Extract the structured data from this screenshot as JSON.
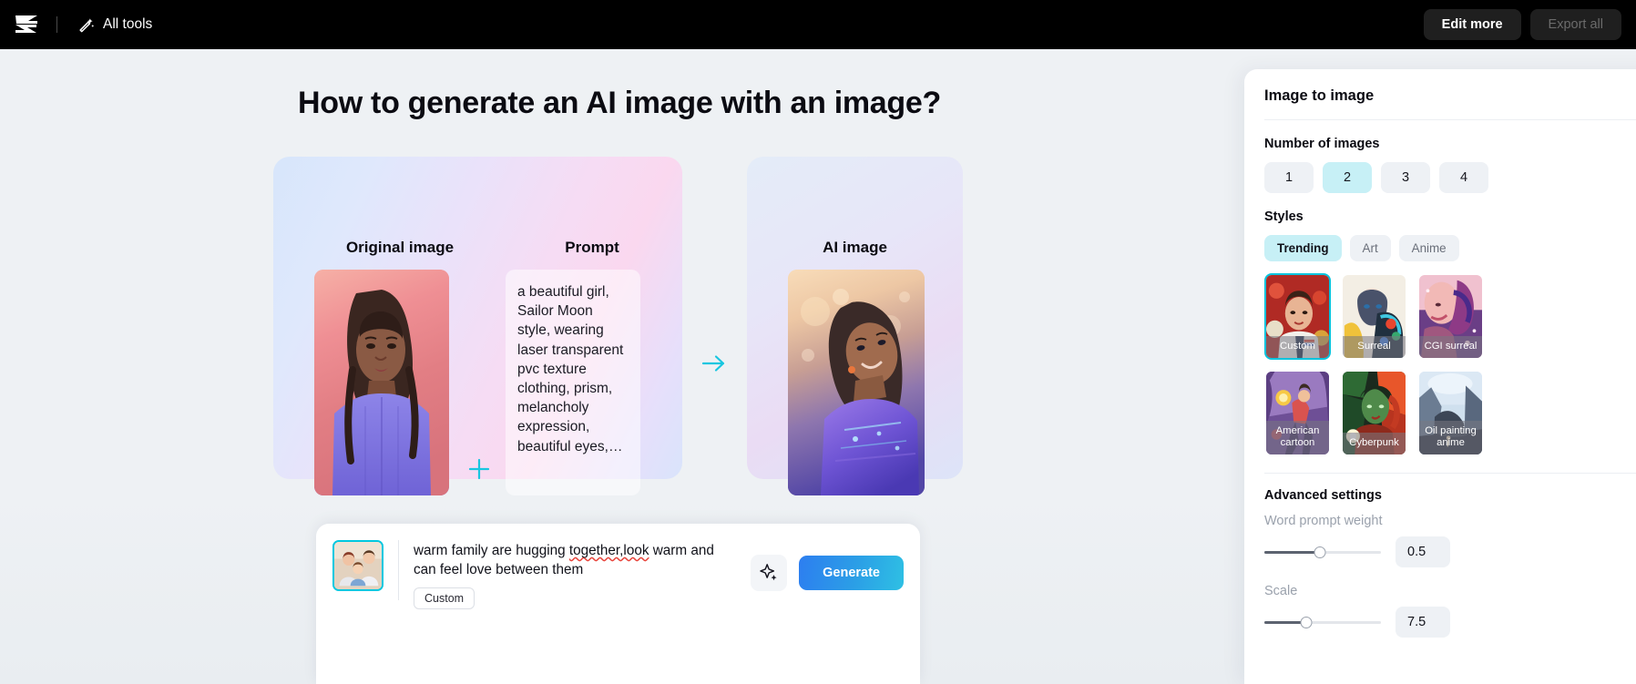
{
  "topbar": {
    "logo_icon": "capcut-logo-icon",
    "all_tools_label": "All tools",
    "wand_icon": "magic-wand-icon",
    "edit_more_label": "Edit more",
    "export_all_label": "Export all"
  },
  "main": {
    "title": "How to generate an AI image with an image?",
    "left_card": {
      "original_heading": "Original image",
      "prompt_heading": "Prompt",
      "prompt_text": "a beautiful girl, Sailor Moon style, wearing laser transparent pvc texture clothing, prism, melancholy expression, beautiful eyes,…",
      "plus_icon": "plus-icon",
      "plus_color": "#18c6e0"
    },
    "arrow_icon": "arrow-right-icon",
    "arrow_color": "#18c6e0",
    "right_card": {
      "ai_heading": "AI image"
    }
  },
  "prompt_bar": {
    "thumbnail_icon": "family-photo-thumbnail",
    "prompt_before": "warm family are hugging ",
    "prompt_misspelled": "together,look",
    "prompt_after": " warm and can feel love between them",
    "style_tag": "Custom",
    "magic_icon": "sparkle-icon",
    "generate_label": "Generate",
    "generate_color": "#2b8fe9"
  },
  "panel": {
    "title": "Image to image",
    "number_of_images": {
      "label": "Number of images",
      "options": [
        "1",
        "2",
        "3",
        "4"
      ],
      "selected": "2"
    },
    "styles": {
      "label": "Styles",
      "tabs": [
        {
          "label": "Trending",
          "selected": true
        },
        {
          "label": "Art",
          "selected": false
        },
        {
          "label": "Anime",
          "selected": false
        }
      ],
      "cards": [
        {
          "name": "Custom",
          "selected": true,
          "two_line": false
        },
        {
          "name": "Surreal",
          "selected": false,
          "two_line": false
        },
        {
          "name": "CGI surreal",
          "selected": false,
          "two_line": false
        },
        {
          "name": "American cartoon",
          "selected": false,
          "two_line": true
        },
        {
          "name": "Cyberpunk",
          "selected": false,
          "two_line": false
        },
        {
          "name": "Oil painting anime",
          "selected": false,
          "two_line": true
        }
      ]
    },
    "advanced": {
      "label": "Advanced settings",
      "word_prompt_weight": {
        "label": "Word prompt weight",
        "value": "0.5",
        "percent": 48
      },
      "scale": {
        "label": "Scale",
        "value": "7.5",
        "percent": 36
      }
    },
    "selected_border_color": "#00c3dd",
    "chip_selected_color": "#c7f0f6"
  }
}
